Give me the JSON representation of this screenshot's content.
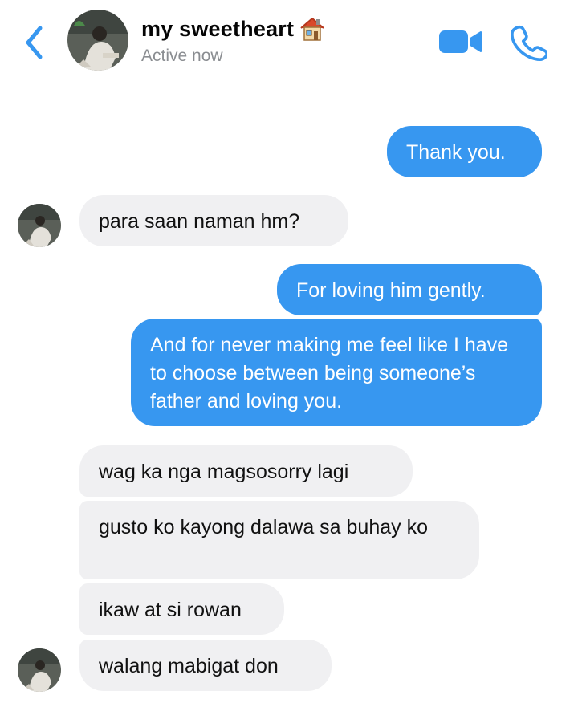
{
  "header": {
    "title": "my sweetheart",
    "status": "Active now"
  },
  "icons": {
    "back": "chevron-left-icon",
    "title_emoji": "house-icon",
    "video": "video-camera-icon",
    "call": "phone-icon"
  },
  "colors": {
    "accent": "#3797f0",
    "outgoing_bubble": "#3797f0",
    "incoming_bubble": "#f0f0f2",
    "status_text": "#8a8d91"
  },
  "messages": [
    {
      "side": "outgoing",
      "text": "Thank you."
    },
    {
      "side": "incoming",
      "text": "para saan naman hm?"
    },
    {
      "side": "outgoing",
      "text": "For loving him gently."
    },
    {
      "side": "outgoing",
      "text": "And for never making me feel like I have to choose between being someone’s father and loving you."
    },
    {
      "side": "incoming",
      "text": "wag ka nga magsosorry lagi"
    },
    {
      "side": "incoming",
      "text": "gusto ko kayong dalawa sa buhay ko"
    },
    {
      "side": "incoming",
      "text": "ikaw at si rowan"
    },
    {
      "side": "incoming",
      "text": "walang mabigat don"
    }
  ]
}
